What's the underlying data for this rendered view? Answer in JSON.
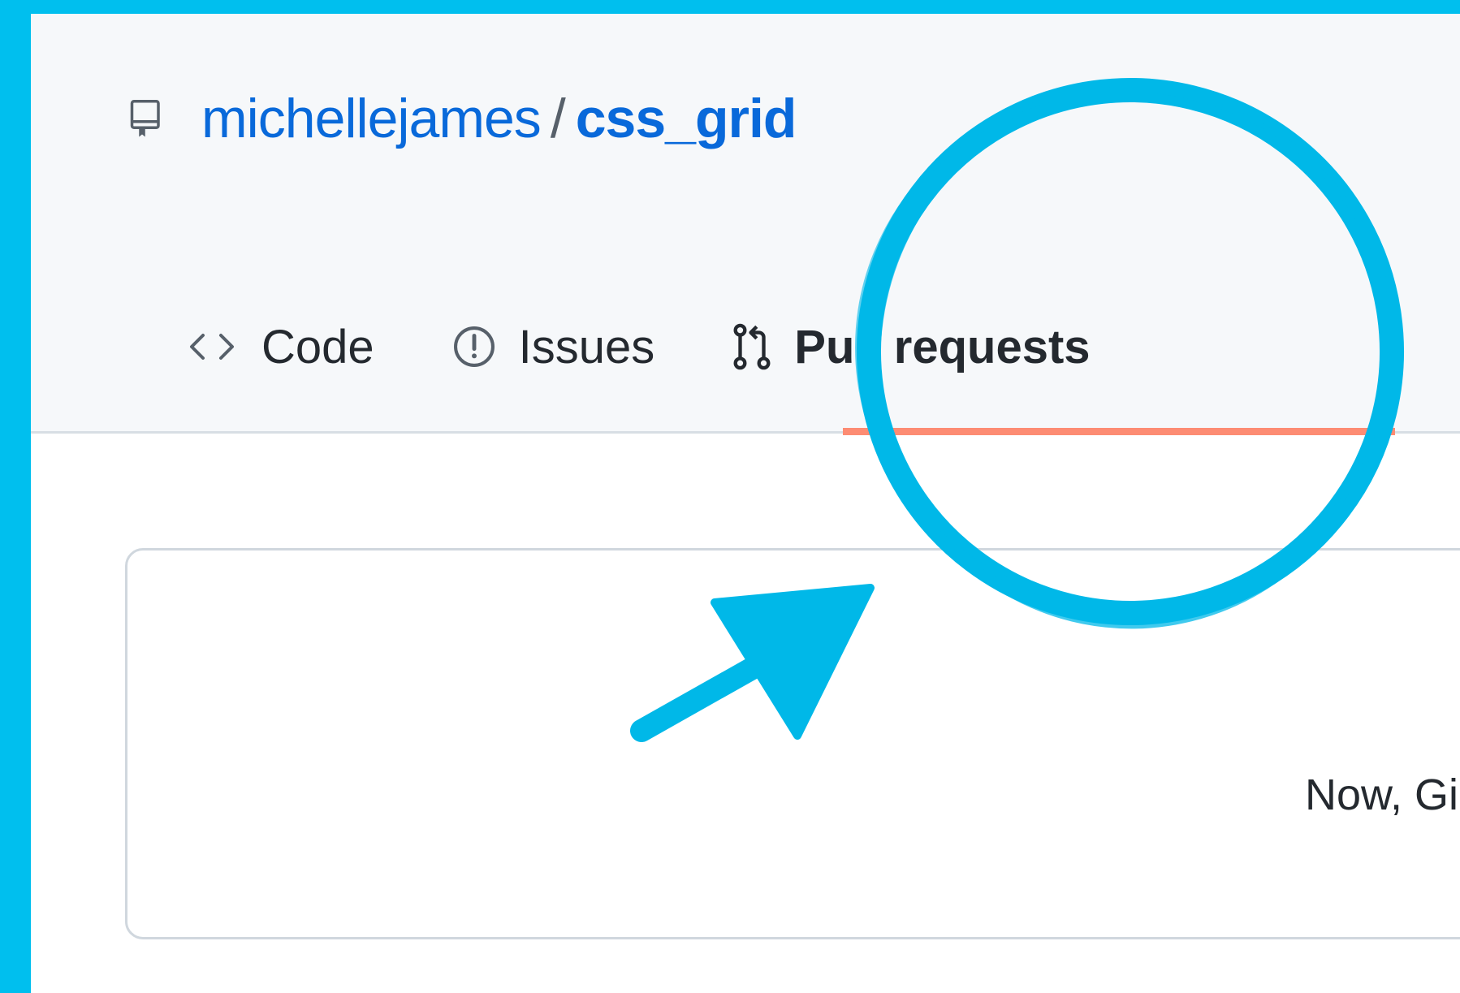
{
  "repo": {
    "owner": "michellejames",
    "separator": "/",
    "name": "css_grid",
    "icon": "repo-icon"
  },
  "tabs": [
    {
      "label": "Code",
      "icon": "code-icon",
      "selected": false
    },
    {
      "label": "Issues",
      "icon": "issue-opened-icon",
      "selected": false
    },
    {
      "label": "Pull requests",
      "icon": "git-pull-request-icon",
      "selected": true
    }
  ],
  "blankslate": {
    "text": "Now, Gi"
  },
  "colors": {
    "background_frame": "#00bfee",
    "link": "#0969da",
    "tab_underline": "#fd8c73",
    "annotation": "#00b8e8"
  }
}
